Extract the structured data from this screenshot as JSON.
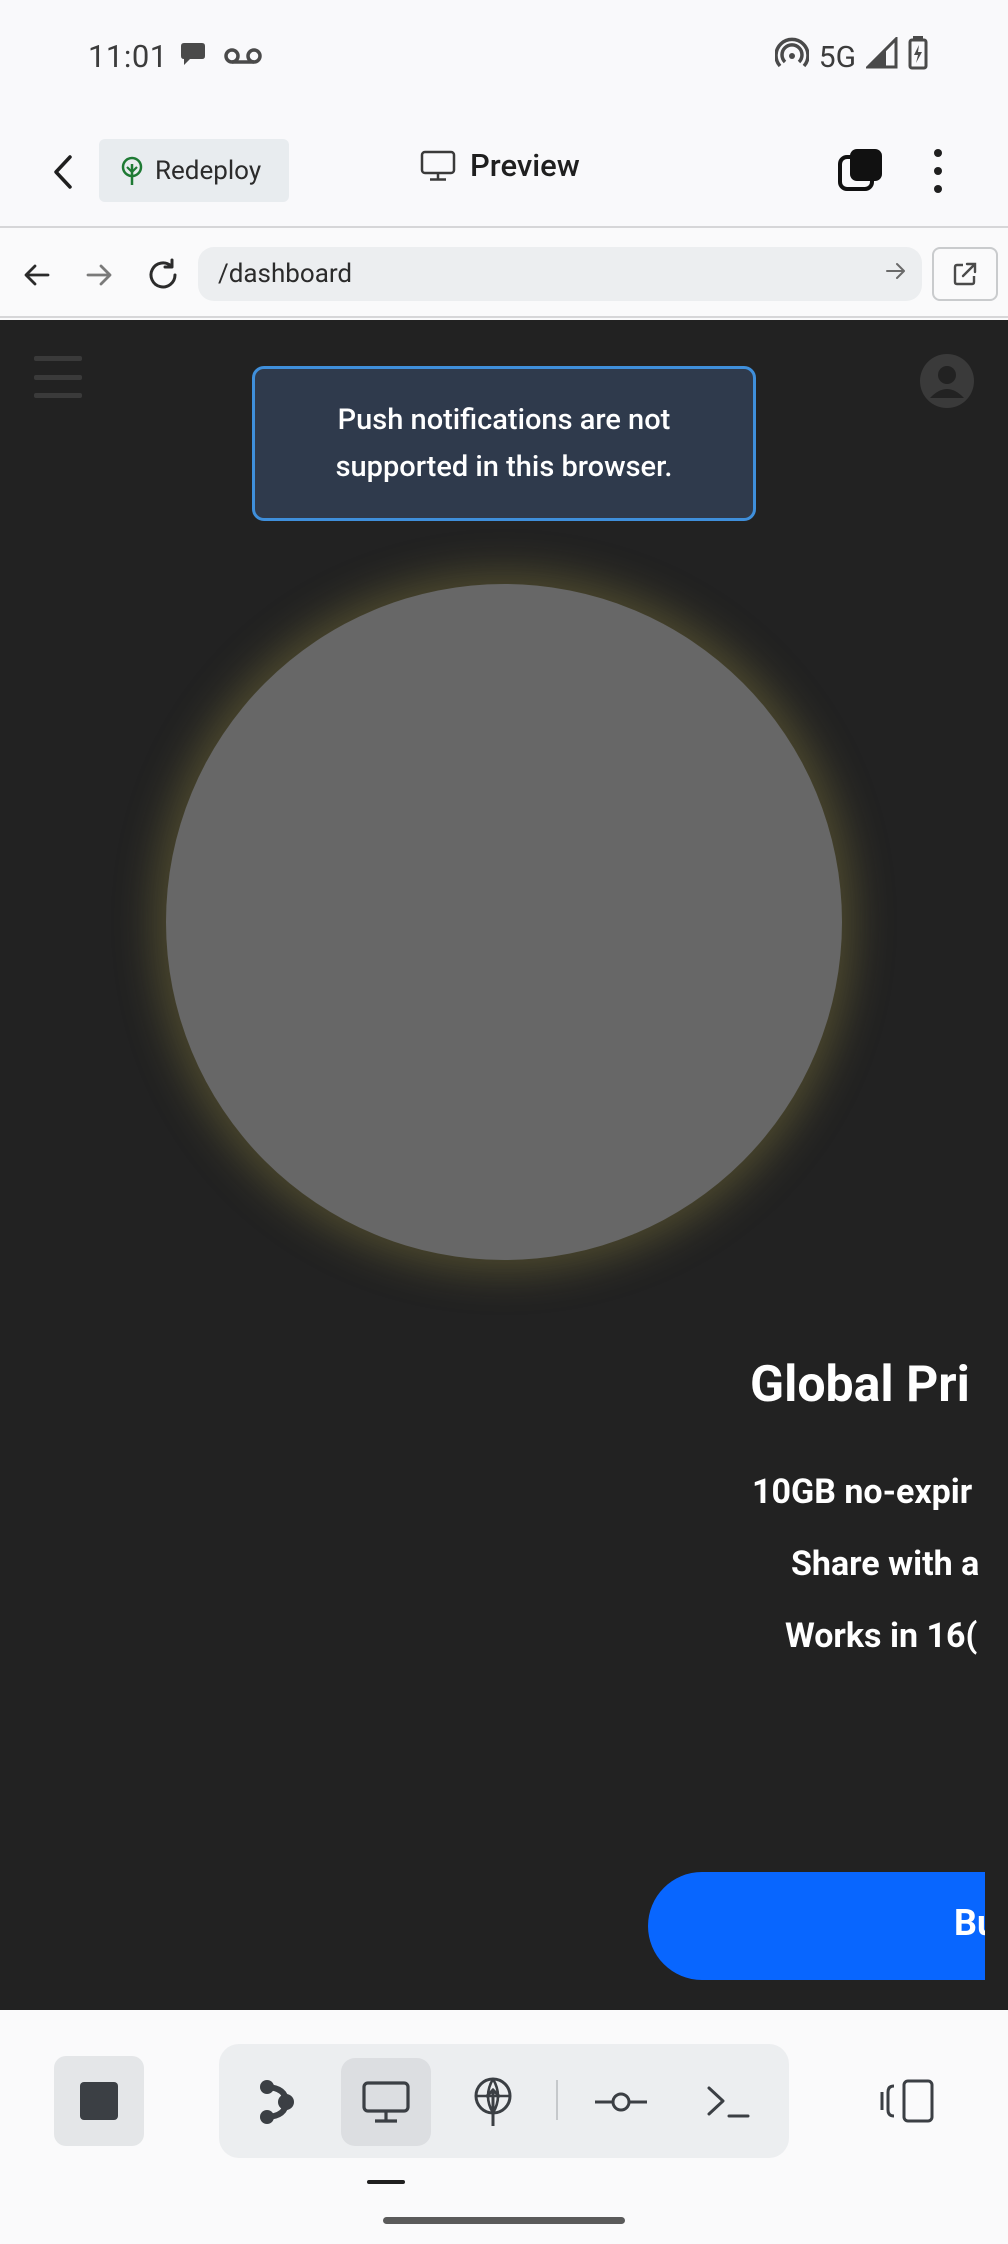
{
  "status_bar": {
    "time": "11:01",
    "network": "5G",
    "icons": [
      "chat-bubble-icon",
      "voicemail-icon",
      "hotspot-icon",
      "signal-icon",
      "battery-charging-icon"
    ]
  },
  "app_bar": {
    "back_icon": "chevron-left-icon",
    "redeploy_label": "Redeploy",
    "title": "Preview",
    "title_icon": "monitor-icon",
    "tabs_icon": "tabs-icon",
    "more_icon": "more-vertical-icon"
  },
  "url_bar": {
    "url": "/dashboard",
    "back_icon": "arrow-left-icon",
    "forward_icon": "arrow-right-icon",
    "reload_icon": "reload-icon",
    "go_icon": "arrow-right-small-icon",
    "open_external_icon": "open-external-icon"
  },
  "webview": {
    "toast": "Push notifications are not supported in this browser.",
    "hero_title": "Global Pri",
    "features": [
      "10GB no-expir",
      "Share with a",
      "Works in 16("
    ],
    "cta_label": "Bu",
    "colors": {
      "background": "#222222",
      "toast_border": "#3f8fdb",
      "toast_bg": "#2f3a4c",
      "cta": "#0866ff",
      "circle": "#676767"
    }
  },
  "bottom_toolbar": {
    "stop_icon": "stop-icon",
    "tools": [
      {
        "name": "agent",
        "icon": "agent-icon",
        "active": false
      },
      {
        "name": "preview",
        "icon": "monitor-icon",
        "active": true
      },
      {
        "name": "deploy",
        "icon": "deploy-globe-icon",
        "active": false
      },
      {
        "name": "commits",
        "icon": "git-commit-icon",
        "active": false
      },
      {
        "name": "terminal",
        "icon": "terminal-icon",
        "active": false
      }
    ],
    "split_icon": "split-view-icon"
  }
}
